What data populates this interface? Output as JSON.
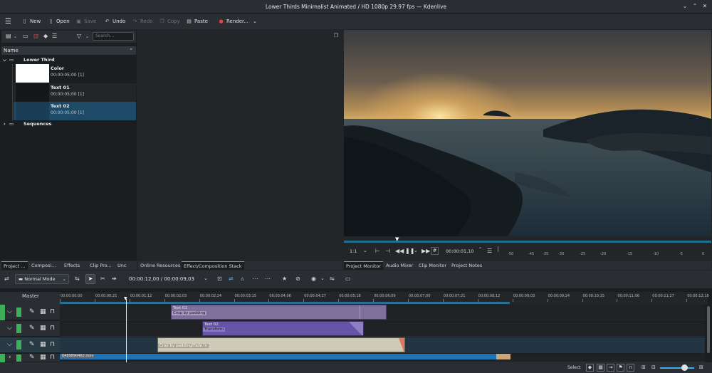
{
  "window": {
    "title": "Lower Thirds Minimalist Animated / HD 1080p 29.97 fps — Kdenlive"
  },
  "toolbar": {
    "new": "New",
    "open": "Open",
    "save": "Save",
    "undo": "Undo",
    "redo": "Redo",
    "copy": "Copy",
    "paste": "Paste",
    "render": "Render..."
  },
  "bin": {
    "search_placeholder": "Search...",
    "column": "Name",
    "folder": "Lower Third",
    "clips": [
      {
        "name": "Color",
        "duration": "00:00:05;00 [1]"
      },
      {
        "name": "Text 01",
        "duration": "00:00:05;00 [1]"
      },
      {
        "name": "Text 02",
        "duration": "00:00:05;00 [1]"
      }
    ],
    "folder2": "Sequences"
  },
  "left_tabs": [
    "Project ...",
    "Composi...",
    "Effects",
    "Clip Pro...",
    "Unc"
  ],
  "center_tabs": [
    "Online Resources",
    "Effect/Composition Stack"
  ],
  "monitor": {
    "zoom": "1:1",
    "timecode": "00:00:01,10",
    "meter_labels": [
      "-50",
      "-45",
      "-35",
      "-30",
      "-25",
      "-20",
      "-15",
      "-10",
      "-5",
      "0"
    ],
    "tabs": [
      "Project Monitor",
      "Audio Mixer",
      "Clip Monitor",
      "Project Notes"
    ]
  },
  "timeline": {
    "mode": "Normal Mode",
    "position": "00:00:12,00 / 00:00:09,03",
    "master": "Master",
    "ruler": [
      "00:00:00:00",
      "00:00:00;21",
      "00:00:01;12",
      "00:00:02;03",
      "00:00:02;24",
      "00:00:03;15",
      "00:00:04;06",
      "00:00:04;27",
      "00:00:05;18",
      "00:00:06;09",
      "00:00:07;00",
      "00:00:07;21",
      "00:00:08;12",
      "00:00:09;03",
      "00:00:09;24",
      "00:00:10;15",
      "00:00:11;06",
      "00:00:11;27",
      "00:00:12;18"
    ],
    "clips": [
      {
        "title": "Text 01",
        "label": "Crop by padding"
      },
      {
        "title": "Text 02",
        "label": "Transform"
      },
      {
        "title": "Color",
        "label": "Crop by padding/Fade In"
      },
      {
        "title": "6489890462.mov",
        "label": ""
      }
    ]
  },
  "status": {
    "select": "Select"
  }
}
